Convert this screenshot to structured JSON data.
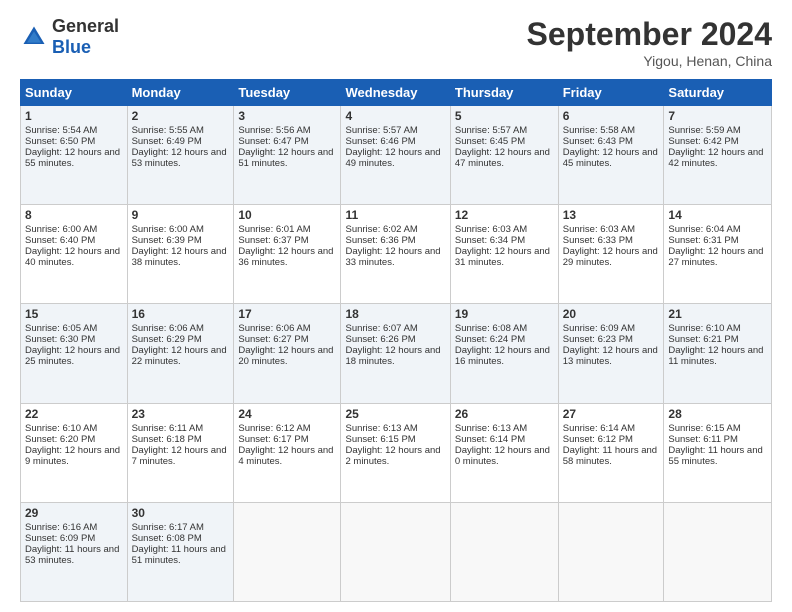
{
  "header": {
    "logo_text_normal": "General",
    "logo_text_blue": "Blue",
    "month_title": "September 2024",
    "location": "Yigou, Henan, China"
  },
  "days_of_week": [
    "Sunday",
    "Monday",
    "Tuesday",
    "Wednesday",
    "Thursday",
    "Friday",
    "Saturday"
  ],
  "weeks": [
    [
      {
        "day": "1",
        "sunrise": "Sunrise: 5:54 AM",
        "sunset": "Sunset: 6:50 PM",
        "daylight": "Daylight: 12 hours and 55 minutes."
      },
      {
        "day": "2",
        "sunrise": "Sunrise: 5:55 AM",
        "sunset": "Sunset: 6:49 PM",
        "daylight": "Daylight: 12 hours and 53 minutes."
      },
      {
        "day": "3",
        "sunrise": "Sunrise: 5:56 AM",
        "sunset": "Sunset: 6:47 PM",
        "daylight": "Daylight: 12 hours and 51 minutes."
      },
      {
        "day": "4",
        "sunrise": "Sunrise: 5:57 AM",
        "sunset": "Sunset: 6:46 PM",
        "daylight": "Daylight: 12 hours and 49 minutes."
      },
      {
        "day": "5",
        "sunrise": "Sunrise: 5:57 AM",
        "sunset": "Sunset: 6:45 PM",
        "daylight": "Daylight: 12 hours and 47 minutes."
      },
      {
        "day": "6",
        "sunrise": "Sunrise: 5:58 AM",
        "sunset": "Sunset: 6:43 PM",
        "daylight": "Daylight: 12 hours and 45 minutes."
      },
      {
        "day": "7",
        "sunrise": "Sunrise: 5:59 AM",
        "sunset": "Sunset: 6:42 PM",
        "daylight": "Daylight: 12 hours and 42 minutes."
      }
    ],
    [
      {
        "day": "8",
        "sunrise": "Sunrise: 6:00 AM",
        "sunset": "Sunset: 6:40 PM",
        "daylight": "Daylight: 12 hours and 40 minutes."
      },
      {
        "day": "9",
        "sunrise": "Sunrise: 6:00 AM",
        "sunset": "Sunset: 6:39 PM",
        "daylight": "Daylight: 12 hours and 38 minutes."
      },
      {
        "day": "10",
        "sunrise": "Sunrise: 6:01 AM",
        "sunset": "Sunset: 6:37 PM",
        "daylight": "Daylight: 12 hours and 36 minutes."
      },
      {
        "day": "11",
        "sunrise": "Sunrise: 6:02 AM",
        "sunset": "Sunset: 6:36 PM",
        "daylight": "Daylight: 12 hours and 33 minutes."
      },
      {
        "day": "12",
        "sunrise": "Sunrise: 6:03 AM",
        "sunset": "Sunset: 6:34 PM",
        "daylight": "Daylight: 12 hours and 31 minutes."
      },
      {
        "day": "13",
        "sunrise": "Sunrise: 6:03 AM",
        "sunset": "Sunset: 6:33 PM",
        "daylight": "Daylight: 12 hours and 29 minutes."
      },
      {
        "day": "14",
        "sunrise": "Sunrise: 6:04 AM",
        "sunset": "Sunset: 6:31 PM",
        "daylight": "Daylight: 12 hours and 27 minutes."
      }
    ],
    [
      {
        "day": "15",
        "sunrise": "Sunrise: 6:05 AM",
        "sunset": "Sunset: 6:30 PM",
        "daylight": "Daylight: 12 hours and 25 minutes."
      },
      {
        "day": "16",
        "sunrise": "Sunrise: 6:06 AM",
        "sunset": "Sunset: 6:29 PM",
        "daylight": "Daylight: 12 hours and 22 minutes."
      },
      {
        "day": "17",
        "sunrise": "Sunrise: 6:06 AM",
        "sunset": "Sunset: 6:27 PM",
        "daylight": "Daylight: 12 hours and 20 minutes."
      },
      {
        "day": "18",
        "sunrise": "Sunrise: 6:07 AM",
        "sunset": "Sunset: 6:26 PM",
        "daylight": "Daylight: 12 hours and 18 minutes."
      },
      {
        "day": "19",
        "sunrise": "Sunrise: 6:08 AM",
        "sunset": "Sunset: 6:24 PM",
        "daylight": "Daylight: 12 hours and 16 minutes."
      },
      {
        "day": "20",
        "sunrise": "Sunrise: 6:09 AM",
        "sunset": "Sunset: 6:23 PM",
        "daylight": "Daylight: 12 hours and 13 minutes."
      },
      {
        "day": "21",
        "sunrise": "Sunrise: 6:10 AM",
        "sunset": "Sunset: 6:21 PM",
        "daylight": "Daylight: 12 hours and 11 minutes."
      }
    ],
    [
      {
        "day": "22",
        "sunrise": "Sunrise: 6:10 AM",
        "sunset": "Sunset: 6:20 PM",
        "daylight": "Daylight: 12 hours and 9 minutes."
      },
      {
        "day": "23",
        "sunrise": "Sunrise: 6:11 AM",
        "sunset": "Sunset: 6:18 PM",
        "daylight": "Daylight: 12 hours and 7 minutes."
      },
      {
        "day": "24",
        "sunrise": "Sunrise: 6:12 AM",
        "sunset": "Sunset: 6:17 PM",
        "daylight": "Daylight: 12 hours and 4 minutes."
      },
      {
        "day": "25",
        "sunrise": "Sunrise: 6:13 AM",
        "sunset": "Sunset: 6:15 PM",
        "daylight": "Daylight: 12 hours and 2 minutes."
      },
      {
        "day": "26",
        "sunrise": "Sunrise: 6:13 AM",
        "sunset": "Sunset: 6:14 PM",
        "daylight": "Daylight: 12 hours and 0 minutes."
      },
      {
        "day": "27",
        "sunrise": "Sunrise: 6:14 AM",
        "sunset": "Sunset: 6:12 PM",
        "daylight": "Daylight: 11 hours and 58 minutes."
      },
      {
        "day": "28",
        "sunrise": "Sunrise: 6:15 AM",
        "sunset": "Sunset: 6:11 PM",
        "daylight": "Daylight: 11 hours and 55 minutes."
      }
    ],
    [
      {
        "day": "29",
        "sunrise": "Sunrise: 6:16 AM",
        "sunset": "Sunset: 6:09 PM",
        "daylight": "Daylight: 11 hours and 53 minutes."
      },
      {
        "day": "30",
        "sunrise": "Sunrise: 6:17 AM",
        "sunset": "Sunset: 6:08 PM",
        "daylight": "Daylight: 11 hours and 51 minutes."
      },
      {
        "day": "",
        "sunrise": "",
        "sunset": "",
        "daylight": ""
      },
      {
        "day": "",
        "sunrise": "",
        "sunset": "",
        "daylight": ""
      },
      {
        "day": "",
        "sunrise": "",
        "sunset": "",
        "daylight": ""
      },
      {
        "day": "",
        "sunrise": "",
        "sunset": "",
        "daylight": ""
      },
      {
        "day": "",
        "sunrise": "",
        "sunset": "",
        "daylight": ""
      }
    ]
  ]
}
